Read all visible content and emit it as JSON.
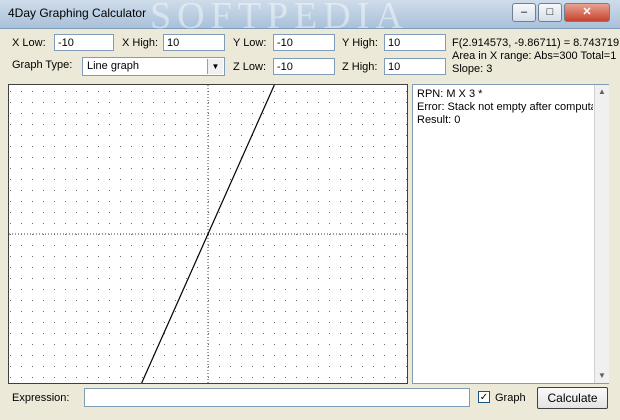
{
  "window": {
    "title": "4Day Graphing Calculator",
    "watermark": "SOFTPEDIA",
    "controls": {
      "minimize": "–",
      "maximize": "□",
      "close": "✕"
    }
  },
  "inputs": {
    "x_low": {
      "label": "X Low:",
      "value": "-10"
    },
    "x_high": {
      "label": "X High:",
      "value": "10"
    },
    "y_low": {
      "label": "Y Low:",
      "value": "-10"
    },
    "y_high": {
      "label": "Y High:",
      "value": "10"
    },
    "z_low": {
      "label": "Z Low:",
      "value": "-10"
    },
    "z_high": {
      "label": "Z High:",
      "value": "10"
    },
    "graph_type": {
      "label": "Graph Type:",
      "value": "Line graph"
    }
  },
  "info": {
    "point": "F(2.914573, -9.86711) = 8.743719",
    "area": "Area in X range: Abs=300 Total=1",
    "slope": "Slope: 3"
  },
  "output": {
    "lines": [
      "RPN: M X 3 *",
      "Error: Stack not empty after computat",
      "Result: 0"
    ]
  },
  "graph": {
    "function_slope": 3,
    "x_range": [
      -10,
      10
    ],
    "y_range": [
      -10,
      10
    ]
  },
  "bottom": {
    "expression_label": "Expression:",
    "expression_value": "",
    "graph_checkbox_label": "Graph",
    "graph_checked": true,
    "calculate_label": "Calculate"
  }
}
